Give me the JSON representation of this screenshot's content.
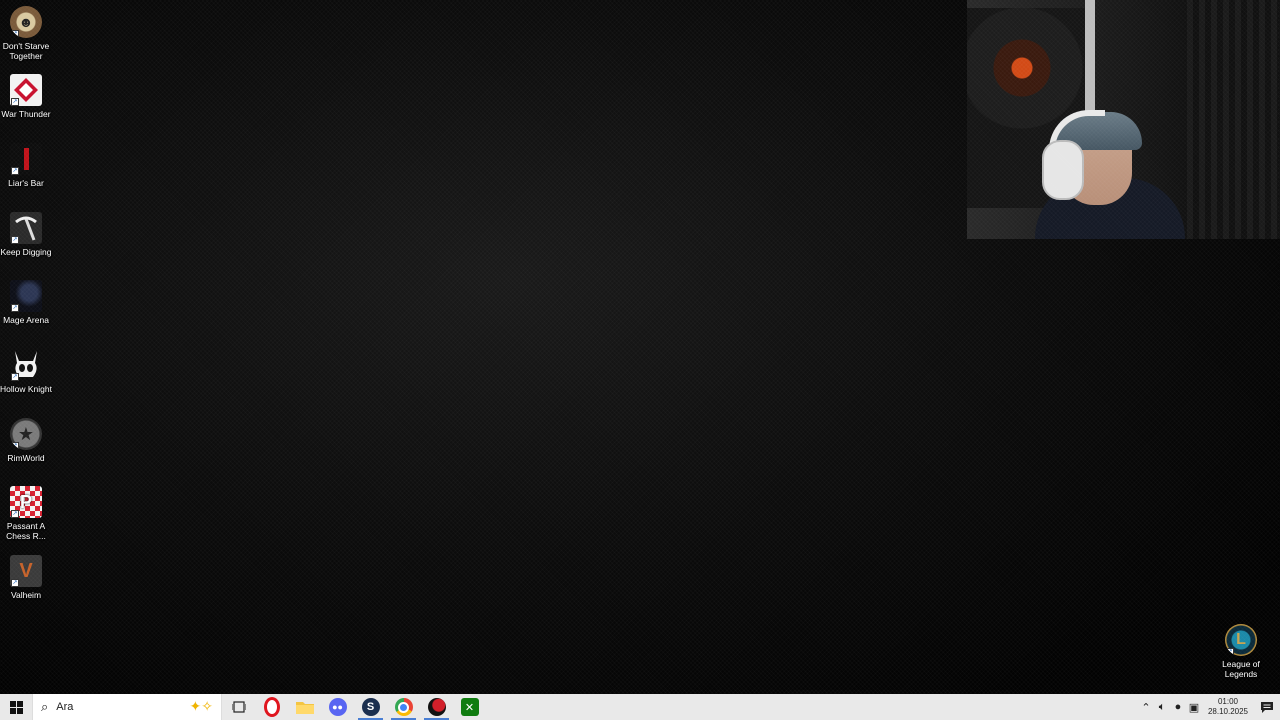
{
  "desktop": {
    "icons": [
      {
        "label": "Don't Starve Together",
        "icon": "dont-starve-icon"
      },
      {
        "label": "War Thunder",
        "icon": "war-thunder-icon"
      },
      {
        "label": "Liar's Bar",
        "icon": "liars-bar-icon"
      },
      {
        "label": "Keep Digging",
        "icon": "pickaxe-icon"
      },
      {
        "label": "Mage Arena",
        "icon": "mage-arena-icon"
      },
      {
        "label": "Hollow Knight",
        "icon": "hollow-knight-icon"
      },
      {
        "label": "RimWorld",
        "icon": "rimworld-icon"
      },
      {
        "label": "Passant A Chess R...",
        "icon": "passant-icon"
      },
      {
        "label": "Valheim",
        "icon": "valheim-icon"
      }
    ],
    "corner_icon": {
      "label": "League of Legends",
      "icon": "league-of-legends-icon"
    }
  },
  "taskbar": {
    "search_placeholder": "Ara",
    "apps": [
      {
        "name": "task-view",
        "icon": "task-view-icon"
      },
      {
        "name": "opera",
        "icon": "opera-icon"
      },
      {
        "name": "file-explorer",
        "icon": "folder-icon"
      },
      {
        "name": "discord",
        "icon": "discord-icon"
      },
      {
        "name": "steam",
        "icon": "steam-icon"
      },
      {
        "name": "chrome",
        "icon": "chrome-icon"
      },
      {
        "name": "app",
        "icon": "red-app-icon"
      },
      {
        "name": "xbox",
        "icon": "xbox-icon"
      }
    ],
    "clock": {
      "time": "01:00",
      "date": "28.10.2025"
    }
  },
  "colors": {
    "taskbar_bg": "#e9e9e9",
    "active_indicator": "#4a7fd4"
  }
}
